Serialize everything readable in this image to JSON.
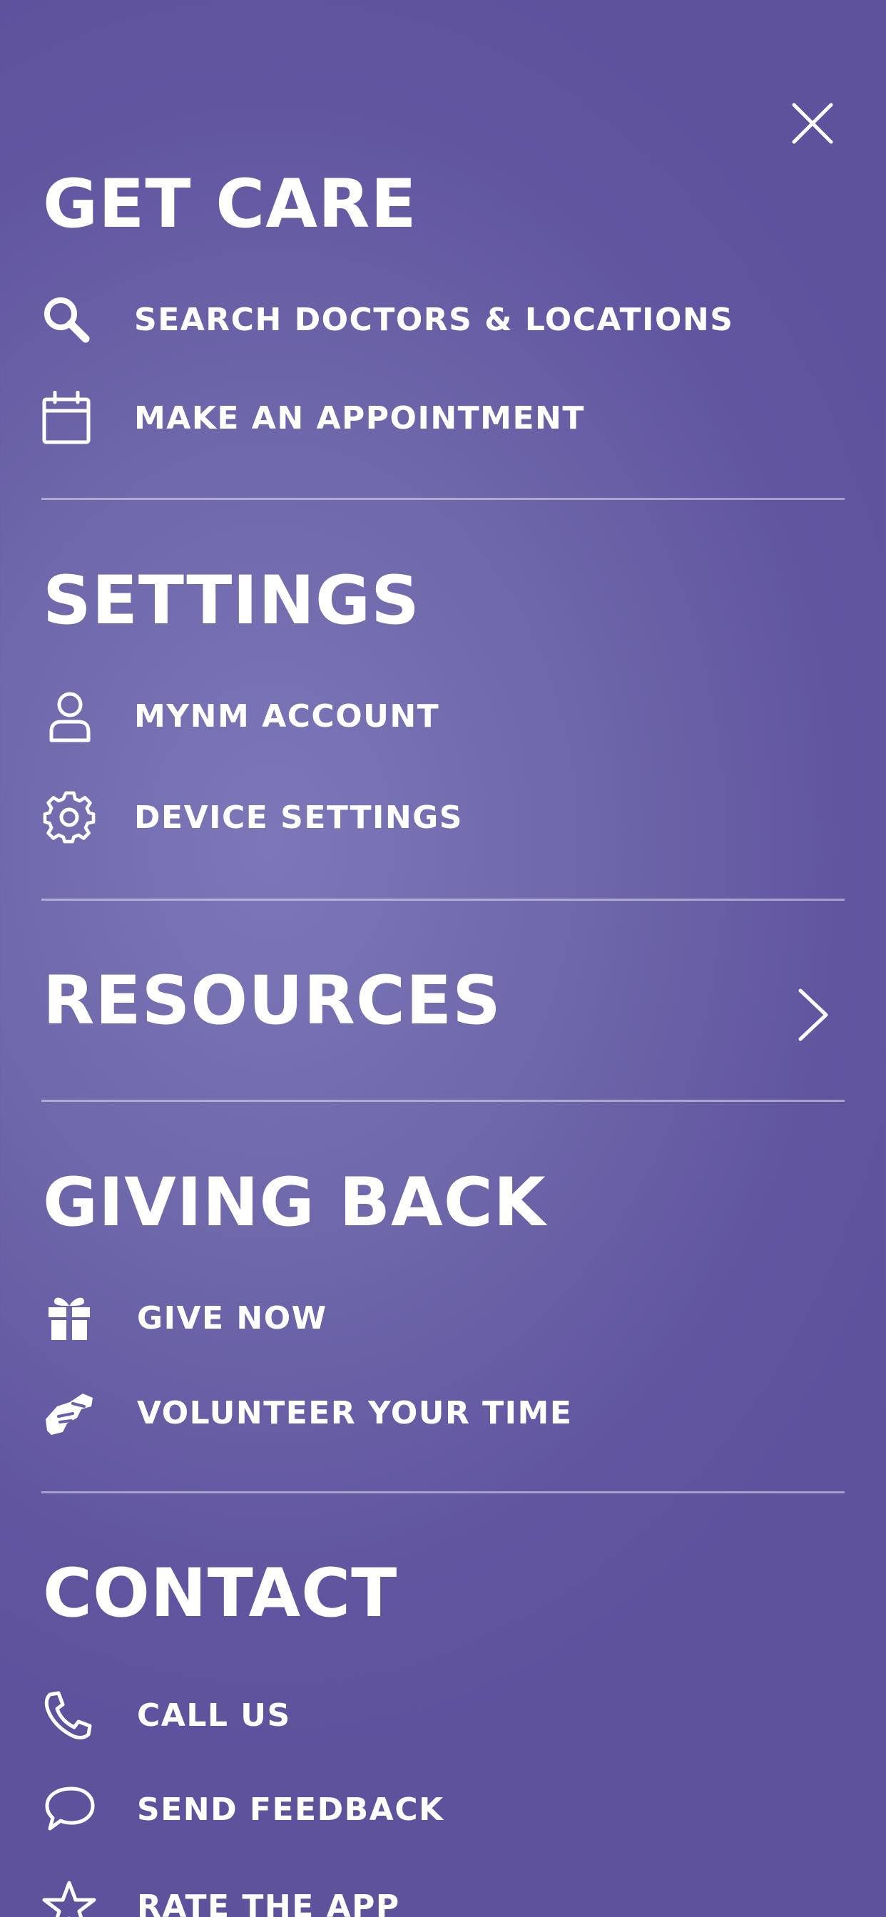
{
  "close": {
    "icon": "close-icon"
  },
  "sections": {
    "get_care": {
      "title": "GET CARE",
      "items": [
        {
          "label": "SEARCH DOCTORS & LOCATIONS",
          "icon": "search-icon"
        },
        {
          "label": "MAKE AN APPOINTMENT",
          "icon": "calendar-icon"
        }
      ]
    },
    "settings": {
      "title": "SETTINGS",
      "items": [
        {
          "label": "MYNM ACCOUNT",
          "icon": "user-icon"
        },
        {
          "label": "DEVICE SETTINGS",
          "icon": "gear-icon"
        }
      ]
    },
    "resources": {
      "title": "RESOURCES",
      "icon": "chevron-right-icon"
    },
    "giving_back": {
      "title": "GIVING BACK",
      "items": [
        {
          "label": "GIVE NOW",
          "icon": "gift-icon"
        },
        {
          "label": "VOLUNTEER YOUR TIME",
          "icon": "handshake-icon"
        }
      ]
    },
    "contact": {
      "title": "CONTACT",
      "items": [
        {
          "label": "CALL US",
          "icon": "phone-icon"
        },
        {
          "label": "SEND FEEDBACK",
          "icon": "chat-bubble-icon"
        },
        {
          "label": "RATE THE APP",
          "icon": "star-icon"
        }
      ]
    }
  },
  "colors": {
    "background_light": "#7c78b8",
    "background_dark": "#5e529d",
    "text": "#ffffff",
    "divider": "#a9a3d0"
  }
}
